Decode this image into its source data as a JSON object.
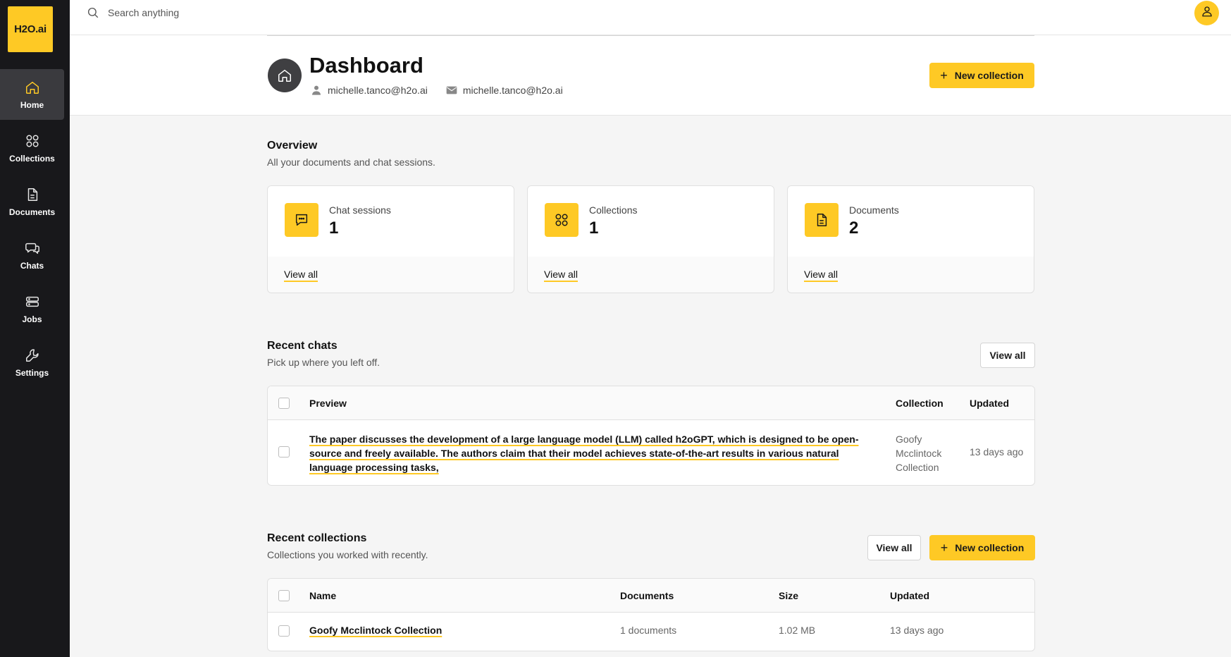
{
  "app": {
    "logo_text": "H2O.ai"
  },
  "nav": {
    "items": [
      {
        "label": "Home",
        "icon": "home-icon"
      },
      {
        "label": "Collections",
        "icon": "grid-icon"
      },
      {
        "label": "Documents",
        "icon": "document-icon"
      },
      {
        "label": "Chats",
        "icon": "chat-icon"
      },
      {
        "label": "Jobs",
        "icon": "server-icon"
      },
      {
        "label": "Settings",
        "icon": "wrench-icon"
      }
    ],
    "active": "Home"
  },
  "search": {
    "placeholder": "Search anything"
  },
  "header": {
    "title": "Dashboard",
    "username": "michelle.tanco@h2o.ai",
    "email": "michelle.tanco@h2o.ai",
    "new_collection_label": "New collection"
  },
  "overview": {
    "title": "Overview",
    "subtitle": "All your documents and chat sessions.",
    "cards": [
      {
        "label": "Chat sessions",
        "value": "1",
        "link": "View all",
        "icon": "chat-bubble-icon"
      },
      {
        "label": "Collections",
        "value": "1",
        "link": "View all",
        "icon": "grid-icon"
      },
      {
        "label": "Documents",
        "value": "2",
        "link": "View all",
        "icon": "document-icon"
      }
    ]
  },
  "recent_chats": {
    "title": "Recent chats",
    "subtitle": "Pick up where you left off.",
    "view_all_label": "View all",
    "columns": [
      "Preview",
      "Collection",
      "Updated"
    ],
    "rows": [
      {
        "preview": "The paper discusses the development of a large language model (LLM) called h2oGPT, which is designed to be open-source and freely available. The authors claim that their model achieves state-of-the-art results in various natural language processing tasks,",
        "collection": "Goofy Mcclintock Collection",
        "updated": "13 days ago"
      }
    ]
  },
  "recent_collections": {
    "title": "Recent collections",
    "subtitle": "Collections you worked with recently.",
    "view_all_label": "View all",
    "new_collection_label": "New collection",
    "columns": [
      "Name",
      "Documents",
      "Size",
      "Updated"
    ],
    "rows": [
      {
        "name": "Goofy Mcclintock Collection",
        "documents": "1 documents",
        "size": "1.02 MB",
        "updated": "13 days ago"
      }
    ]
  },
  "colors": {
    "accent": "#fec925",
    "sidebar": "#18181b",
    "active_nav": "#3a3a3e"
  }
}
